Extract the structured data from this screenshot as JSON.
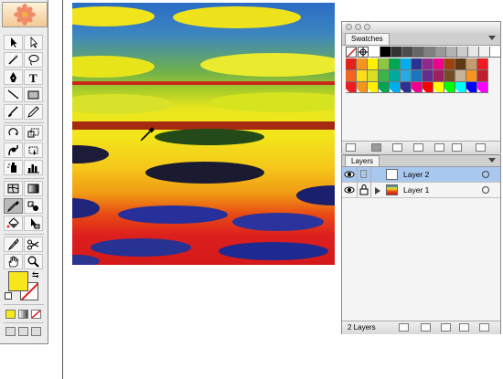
{
  "toolbox": {
    "icons": [
      "selection-arrow",
      "direct-selection-arrow",
      "magic-wand",
      "lasso",
      "pen",
      "type",
      "line-segment",
      "rectangle",
      "paintbrush",
      "pencil",
      "rotate",
      "scale",
      "warp",
      "free-transform",
      "symbol-sprayer",
      "column-graph",
      "mesh",
      "gradient",
      "eyedropper",
      "blend",
      "live-paint-bucket",
      "live-paint-selection",
      "slice",
      "scissors",
      "hand",
      "zoom"
    ],
    "fill_color": "#f6e61a",
    "stroke_color": "none"
  },
  "swatches_panel": {
    "tab_label": "Swatches",
    "row1": [
      "#ffffff",
      "#000000",
      "#333333",
      "#4d4d4d",
      "#666666",
      "#808080",
      "#999999",
      "#b3b3b3",
      "#cccccc",
      "#e6e6e6",
      "#f2f2f2",
      "#ffffff"
    ],
    "row2": [
      "#e2231a",
      "#f7931e",
      "#fff200",
      "#8dc63f",
      "#00a651",
      "#00aeef",
      "#2e3192",
      "#92278f",
      "#ec008c",
      "#a0410d",
      "#603913",
      "#c69c6d",
      "#ed1c24"
    ],
    "row3": [
      "#f26522",
      "#ffde17",
      "#d7df23",
      "#39b54a",
      "#00a99d",
      "#27aae1",
      "#1c75bc",
      "#662d91",
      "#9e1f63",
      "#754c24",
      "#c7b299",
      "#f7941d",
      "#be1e2d"
    ],
    "row4": [
      "#ed1c24",
      "#f7941d",
      "#fff200",
      "#00a651",
      "#00aeef",
      "#2e3192",
      "#ec008c",
      "#ff0000",
      "#ffff00",
      "#00ff00",
      "#00ffff",
      "#0000ff",
      "#ff00ff"
    ]
  },
  "layers_panel": {
    "tab_label": "Layers",
    "rows": [
      {
        "name": "Layer 2",
        "selected": true,
        "expander": false
      },
      {
        "name": "Layer 1",
        "selected": false,
        "expander": true
      }
    ],
    "layer_count": "2 Layers"
  }
}
